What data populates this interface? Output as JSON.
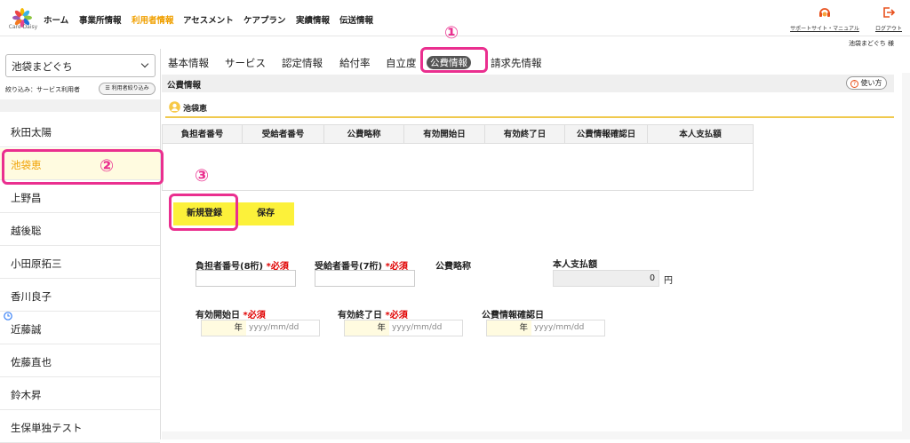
{
  "header": {
    "logo_text": "Care Daisy",
    "nav": [
      "ホーム",
      "事業所情報",
      "利用者情報",
      "アセスメント",
      "ケアプラン",
      "実績情報",
      "伝送情報"
    ],
    "active_nav_index": 2,
    "support_link": "サポートサイト・マニュアル",
    "logout_link": "ログアウト",
    "user_greeting": "池袋まどぐち 様"
  },
  "sidebar": {
    "office": "池袋まどぐち",
    "filter_label": "絞り込み：サービス利用者",
    "filter_button": "利用者絞り込み",
    "users": [
      "秋田太陽",
      "池袋恵",
      "上野昌",
      "越後聡",
      "小田原拓三",
      "香川良子",
      "近藤誠",
      "佐藤直也",
      "鈴木昇",
      "生保単独テスト"
    ],
    "selected_index": 1
  },
  "tabs": [
    "基本情報",
    "サービス",
    "認定情報",
    "給付率",
    "自立度",
    "公費情報",
    "請求先情報"
  ],
  "active_tab_index": 5,
  "section": {
    "title": "公費情報",
    "howto_button": "使い方",
    "person_name": "池袋恵"
  },
  "table": {
    "columns": [
      "負担者番号",
      "受給者番号",
      "公費略称",
      "有効開始日",
      "有効終了日",
      "公費情報確認日",
      "本人支払額"
    ]
  },
  "buttons": {
    "new_register": "新規登録",
    "save": "保存"
  },
  "form": {
    "burden_no_label": "負担者番号(8桁)",
    "recipient_no_label": "受給者番号(7桁)",
    "required": "*必須",
    "abbreviation_label": "公費略称",
    "self_pay_label": "本人支払額",
    "self_pay_value": "0",
    "self_pay_unit": "円",
    "start_label": "有効開始日",
    "end_label": "有効終了日",
    "confirm_label": "公費情報確認日",
    "year_suffix": "年",
    "date_placeholder": "yyyy/mm/dd"
  },
  "annotations": [
    "①",
    "②",
    "③"
  ],
  "colors": {
    "accent": "#f0a000",
    "highlight_button": "#fcf13a",
    "annotation": "#ea2f8f",
    "required": "#e00000"
  }
}
